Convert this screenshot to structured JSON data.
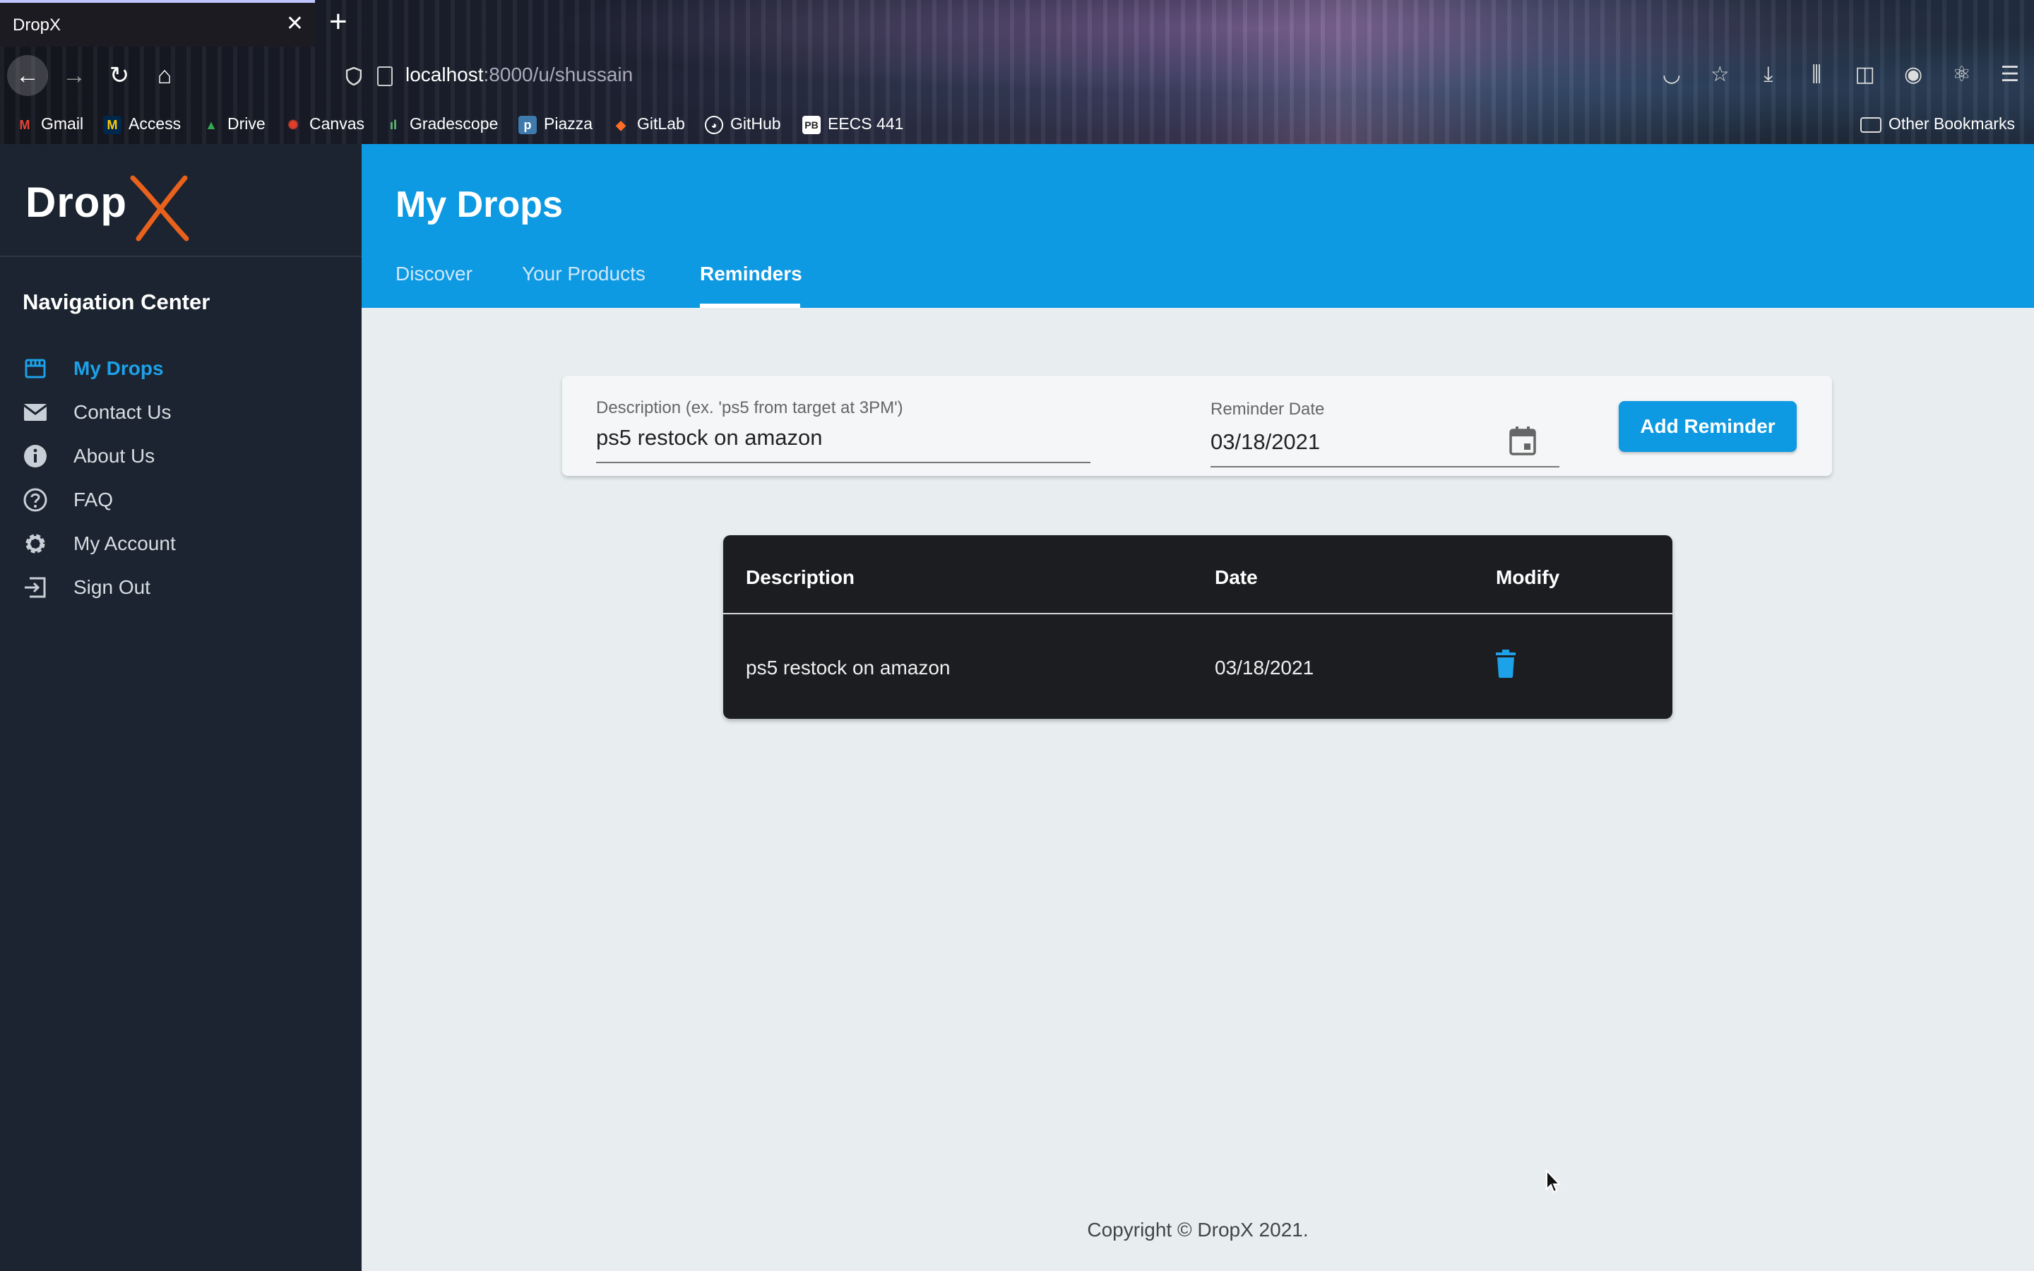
{
  "browser": {
    "tab_title": "DropX",
    "url_host": "localhost",
    "url_path": ":8000/u/shussain",
    "bookmarks": [
      "Gmail",
      "Access",
      "Drive",
      "Canvas",
      "Gradescope",
      "Piazza",
      "GitLab",
      "GitHub",
      "EECS 441"
    ],
    "other_bookmarks": "Other Bookmarks"
  },
  "sidebar": {
    "logo_text": "Drop",
    "nav_title": "Navigation Center",
    "items": [
      {
        "label": "My Drops",
        "icon": "store-icon",
        "active": true
      },
      {
        "label": "Contact Us",
        "icon": "mail-icon",
        "active": false
      },
      {
        "label": "About Us",
        "icon": "info-icon",
        "active": false
      },
      {
        "label": "FAQ",
        "icon": "help-circle-icon",
        "active": false
      },
      {
        "label": "My Account",
        "icon": "gear-icon",
        "active": false
      },
      {
        "label": "Sign Out",
        "icon": "sign-out-icon",
        "active": false
      }
    ]
  },
  "header": {
    "title": "My Drops",
    "tabs": [
      {
        "label": "Discover",
        "active": false
      },
      {
        "label": "Your Products",
        "active": false
      },
      {
        "label": "Reminders",
        "active": true
      }
    ]
  },
  "form": {
    "description_label": "Description (ex. 'ps5 from target at 3PM')",
    "description_value": "ps5 restock on amazon",
    "date_label": "Reminder Date",
    "date_value": "03/18/2021",
    "add_button": "Add Reminder"
  },
  "table": {
    "headers": [
      "Description",
      "Date",
      "Modify"
    ],
    "rows": [
      {
        "description": "ps5 restock on amazon",
        "date": "03/18/2021"
      }
    ]
  },
  "footer": {
    "copyright": "Copyright © DropX 2021."
  },
  "colors": {
    "accent": "#0d9ae3",
    "sidebar_bg": "#1b2430",
    "logo_x": "#e8611d",
    "table_bg": "#1b1d21"
  }
}
